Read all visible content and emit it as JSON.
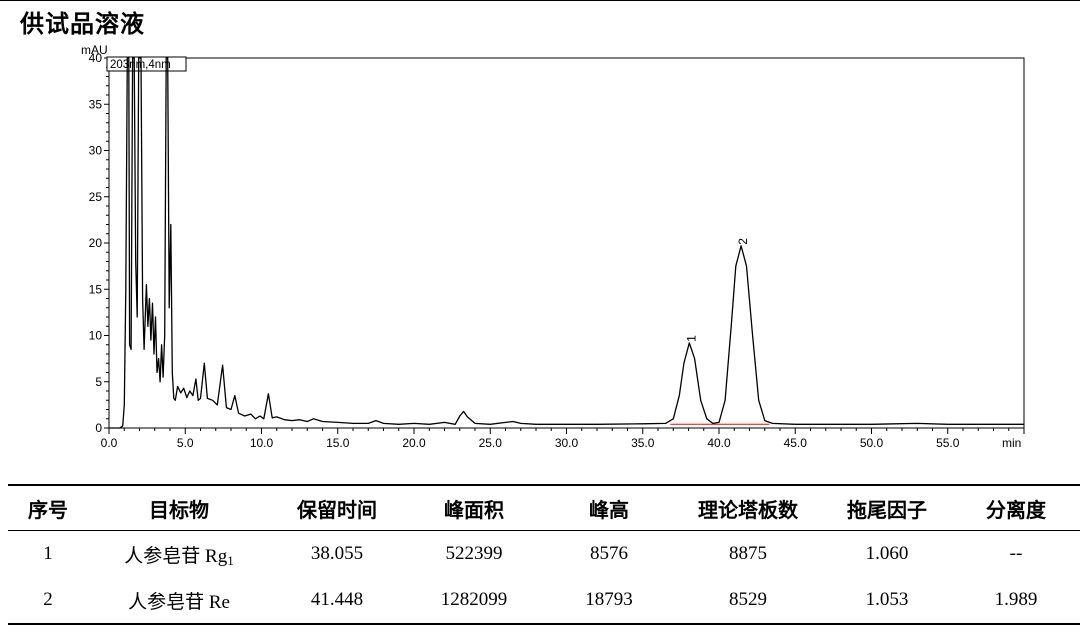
{
  "header": {
    "title": "供试品溶液"
  },
  "chart_data": {
    "type": "line",
    "title": "",
    "ylabel": "mAU",
    "xlabel": "min",
    "xlim": [
      0,
      60
    ],
    "ylim": [
      0,
      40
    ],
    "x_ticks": [
      0,
      5,
      10,
      15,
      20,
      25,
      30,
      35,
      40,
      45,
      50,
      55
    ],
    "x_tick_labels": [
      "0.0",
      "5.0",
      "10.0",
      "15.0",
      "20.0",
      "25.0",
      "30.0",
      "35.0",
      "40.0",
      "45.0",
      "50.0",
      "55.0"
    ],
    "y_ticks": [
      0,
      5,
      10,
      15,
      20,
      25,
      30,
      35,
      40
    ],
    "y_tick_labels": [
      "0",
      "5",
      "10",
      "15",
      "20",
      "25",
      "30",
      "35",
      "40"
    ],
    "grid": false,
    "legend": {
      "text": "203nm,4nm",
      "placement": "top-left"
    },
    "baseline_color": "#ff0000",
    "series": [
      {
        "color": "#000000",
        "points": [
          [
            0,
            0
          ],
          [
            0.7,
            0
          ],
          [
            0.9,
            0.2
          ],
          [
            1.0,
            2.5
          ],
          [
            1.1,
            15
          ],
          [
            1.2,
            40
          ],
          [
            1.3,
            40
          ],
          [
            1.35,
            9
          ],
          [
            1.45,
            8.5
          ],
          [
            1.55,
            40
          ],
          [
            1.65,
            40
          ],
          [
            1.75,
            18
          ],
          [
            1.85,
            12
          ],
          [
            1.95,
            40
          ],
          [
            2.1,
            40
          ],
          [
            2.2,
            14
          ],
          [
            2.3,
            8.5
          ],
          [
            2.45,
            15.5
          ],
          [
            2.55,
            11
          ],
          [
            2.65,
            14
          ],
          [
            2.75,
            9.5
          ],
          [
            2.85,
            13.5
          ],
          [
            2.95,
            8
          ],
          [
            3.05,
            12
          ],
          [
            3.15,
            6
          ],
          [
            3.25,
            7.5
          ],
          [
            3.35,
            5
          ],
          [
            3.45,
            9
          ],
          [
            3.55,
            5.5
          ],
          [
            3.65,
            10
          ],
          [
            3.75,
            40
          ],
          [
            3.85,
            40
          ],
          [
            3.95,
            13
          ],
          [
            4.05,
            22
          ],
          [
            4.15,
            6
          ],
          [
            4.25,
            3.2
          ],
          [
            4.35,
            3.0
          ],
          [
            4.5,
            4.5
          ],
          [
            4.7,
            3.8
          ],
          [
            4.9,
            4.3
          ],
          [
            5.1,
            3.3
          ],
          [
            5.3,
            4.0
          ],
          [
            5.5,
            3.5
          ],
          [
            5.7,
            5.3
          ],
          [
            5.85,
            3.0
          ],
          [
            6.0,
            3.2
          ],
          [
            6.25,
            7.0
          ],
          [
            6.45,
            3.2
          ],
          [
            6.8,
            3.0
          ],
          [
            7.1,
            2.5
          ],
          [
            7.45,
            6.8
          ],
          [
            7.7,
            2.2
          ],
          [
            8.0,
            2.0
          ],
          [
            8.25,
            3.5
          ],
          [
            8.5,
            1.6
          ],
          [
            8.9,
            1.3
          ],
          [
            9.3,
            1.5
          ],
          [
            9.6,
            1.0
          ],
          [
            9.9,
            1.3
          ],
          [
            10.15,
            1.0
          ],
          [
            10.45,
            3.7
          ],
          [
            10.7,
            1.1
          ],
          [
            11.0,
            1.2
          ],
          [
            11.5,
            0.9
          ],
          [
            12.0,
            0.8
          ],
          [
            12.5,
            0.9
          ],
          [
            13.0,
            0.7
          ],
          [
            13.4,
            1.0
          ],
          [
            14.0,
            0.7
          ],
          [
            15.0,
            0.6
          ],
          [
            16.0,
            0.5
          ],
          [
            17.0,
            0.5
          ],
          [
            17.5,
            0.8
          ],
          [
            18.0,
            0.5
          ],
          [
            19.0,
            0.4
          ],
          [
            20.0,
            0.5
          ],
          [
            21.0,
            0.4
          ],
          [
            22.0,
            0.6
          ],
          [
            22.7,
            0.4
          ],
          [
            23.0,
            1.3
          ],
          [
            23.25,
            1.8
          ],
          [
            23.5,
            1.2
          ],
          [
            24.0,
            0.5
          ],
          [
            25.0,
            0.4
          ],
          [
            26.0,
            0.6
          ],
          [
            26.5,
            0.7
          ],
          [
            27.0,
            0.5
          ],
          [
            28.0,
            0.4
          ],
          [
            30.0,
            0.4
          ],
          [
            32.0,
            0.4
          ],
          [
            35.0,
            0.45
          ],
          [
            36.5,
            0.5
          ],
          [
            37.0,
            1.0
          ],
          [
            37.4,
            3.5
          ],
          [
            37.7,
            7.0
          ],
          [
            38.055,
            9.2
          ],
          [
            38.4,
            7.5
          ],
          [
            38.8,
            3.0
          ],
          [
            39.2,
            1.0
          ],
          [
            39.6,
            0.5
          ],
          [
            40.0,
            0.6
          ],
          [
            40.4,
            3.0
          ],
          [
            40.8,
            11.0
          ],
          [
            41.1,
            17.5
          ],
          [
            41.448,
            19.7
          ],
          [
            41.8,
            17.5
          ],
          [
            42.2,
            10.0
          ],
          [
            42.6,
            3.0
          ],
          [
            43.0,
            0.8
          ],
          [
            43.5,
            0.5
          ],
          [
            45.0,
            0.4
          ],
          [
            50.0,
            0.4
          ],
          [
            53.0,
            0.5
          ],
          [
            55.0,
            0.4
          ],
          [
            60.0,
            0.4
          ]
        ]
      }
    ],
    "peak_labels": [
      {
        "text": "1",
        "x": 38.055,
        "y": 9.2
      },
      {
        "text": "2",
        "x": 41.448,
        "y": 19.7
      }
    ],
    "baselines": [
      [
        36.8,
        40.0
      ],
      [
        40.0,
        43.3
      ]
    ]
  },
  "table": {
    "headers": [
      "序号",
      "目标物",
      "保留时间",
      "峰面积",
      "峰高",
      "理论塔板数",
      "拖尾因子",
      "分离度"
    ],
    "rows": [
      {
        "no": "1",
        "name": "人参皂苷 R",
        "name_suffix": "g",
        "name_sub": "1",
        "rt": "38.055",
        "area": "522399",
        "height": "8576",
        "plates": "8875",
        "tailing": "1.060",
        "resolution": "--"
      },
      {
        "no": "2",
        "name": "人参皂苷 Re",
        "name_suffix": "",
        "name_sub": "",
        "rt": "41.448",
        "area": "1282099",
        "height": "18793",
        "plates": "8529",
        "tailing": "1.053",
        "resolution": "1.989"
      }
    ]
  }
}
